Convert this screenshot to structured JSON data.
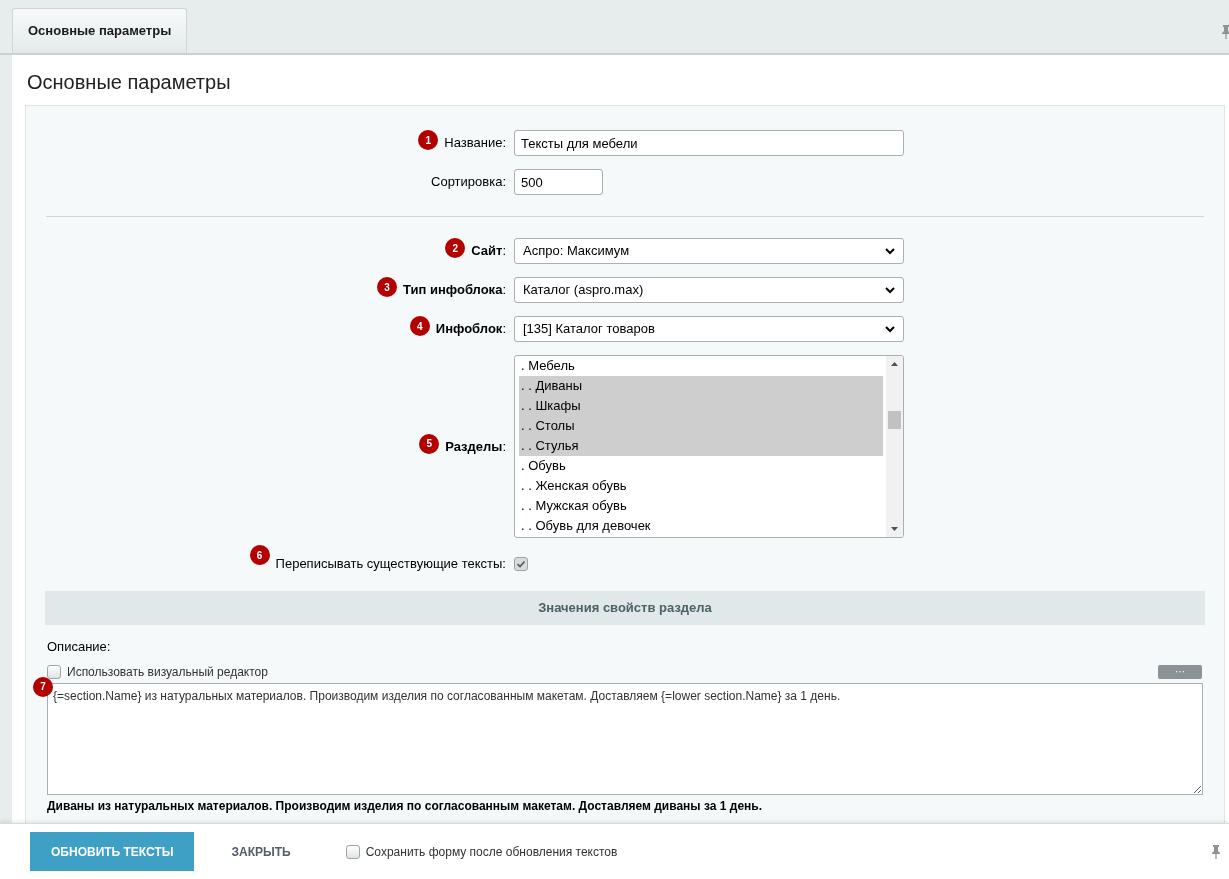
{
  "tabs": [
    {
      "label": "Основные параметры",
      "selected": true
    }
  ],
  "page_title": "Основные параметры",
  "fields": [
    {
      "kind": "text",
      "marker": "1",
      "label": "Название:",
      "value": "Тексты для мебели",
      "wide": true
    },
    {
      "kind": "text",
      "label": "Сортировка:",
      "value": "500",
      "wide": false
    },
    {
      "kind": "divider"
    },
    {
      "kind": "select",
      "marker": "2",
      "label": "**Сайт**:",
      "value": "Аспро: Максимум"
    },
    {
      "kind": "select",
      "marker": "3",
      "label": "**Тип инфоблока**:",
      "value": "Каталог (aspro.max)"
    },
    {
      "kind": "select",
      "marker": "4",
      "label": "**Инфоблок**:",
      "value": "[135] Каталог товаров"
    },
    {
      "kind": "listbox",
      "marker": "5",
      "label": "**Разделы**:",
      "options": [
        {
          "label": ". Мебель",
          "selected": false
        },
        {
          "label": ". . Диваны",
          "selected": true
        },
        {
          "label": ". . Шкафы",
          "selected": true
        },
        {
          "label": ". . Столы",
          "selected": true
        },
        {
          "label": ". . Стулья",
          "selected": true
        },
        {
          "label": ". Обувь",
          "selected": false
        },
        {
          "label": ". . Женская обувь",
          "selected": false
        },
        {
          "label": ". . Мужская обувь",
          "selected": false
        },
        {
          "label": ". . Обувь для девочек",
          "selected": false
        }
      ]
    },
    {
      "kind": "checkbox",
      "marker": "6",
      "label": "Переписывать существующие тексты:",
      "checked": true
    }
  ],
  "section_header": "Значения свойств раздела",
  "description": {
    "label": "Описание:",
    "visual_editor": {
      "label": "Использовать визуальный редактор",
      "checked": false
    },
    "more_button": "···",
    "marker": "7",
    "value": "{=section.Name} из натуральных материалов. Производим изделия по согласованным макетам. Доставляем {=lower section.Name} за 1 день.",
    "preview": "Диваны из натуральных материалов. Производим изделия по согласованным макетам. Доставляем диваны за 1 день."
  },
  "footer": {
    "primary_button": "ОБНОВИТЬ ТЕКСТЫ",
    "secondary_button": "ЗАКРЫТЬ",
    "save_form": {
      "label": "Сохранить форму после обновления текстов",
      "checked": false
    }
  }
}
